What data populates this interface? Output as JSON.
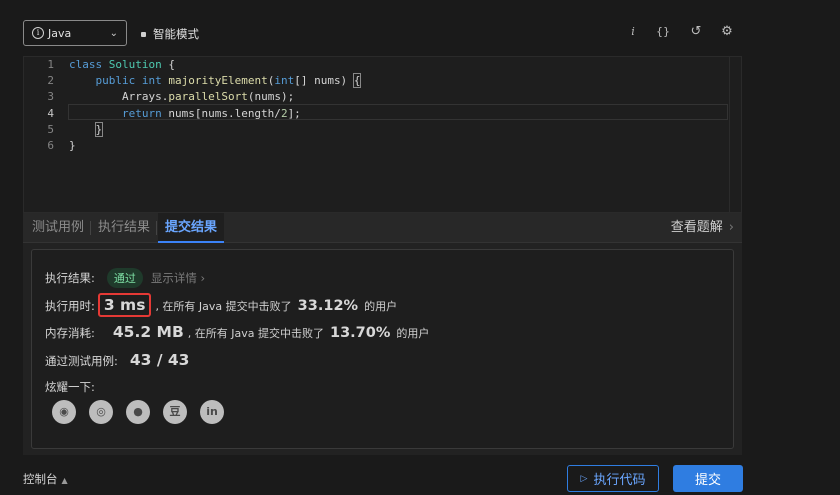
{
  "toolbar": {
    "language": "Java",
    "smart_mode": "智能模式",
    "icons": [
      "info-icon",
      "braces-icon",
      "reset-icon",
      "settings-icon"
    ],
    "icon_glyphs": {
      "info": "i",
      "braces": "{}",
      "reset": "↺",
      "settings": "⚙"
    }
  },
  "editor": {
    "active_line": 4,
    "lines": [
      {
        "num": "1",
        "tokens": [
          {
            "t": "class ",
            "c": "kw"
          },
          {
            "t": "Solution",
            "c": "ty"
          },
          {
            "t": " {",
            "c": "pl"
          }
        ]
      },
      {
        "num": "2",
        "tokens": [
          {
            "t": "    ",
            "c": "pl"
          },
          {
            "t": "public ",
            "c": "kw"
          },
          {
            "t": "int ",
            "c": "kw"
          },
          {
            "t": "majorityElement",
            "c": "fn"
          },
          {
            "t": "(",
            "c": "pl"
          },
          {
            "t": "int",
            "c": "kw"
          },
          {
            "t": "[] nums) ",
            "c": "pl"
          },
          {
            "t": "{",
            "c": "br"
          }
        ]
      },
      {
        "num": "3",
        "tokens": [
          {
            "t": "        Arrays.",
            "c": "pl"
          },
          {
            "t": "parallelSort",
            "c": "fn"
          },
          {
            "t": "(nums);",
            "c": "pl"
          }
        ]
      },
      {
        "num": "4",
        "tokens": [
          {
            "t": "        ",
            "c": "pl"
          },
          {
            "t": "return ",
            "c": "kw"
          },
          {
            "t": "nums[nums.length/",
            "c": "pl"
          },
          {
            "t": "2",
            "c": "nu"
          },
          {
            "t": "];",
            "c": "pl"
          }
        ]
      },
      {
        "num": "5",
        "tokens": [
          {
            "t": "    ",
            "c": "pl"
          },
          {
            "t": "}",
            "c": "br"
          }
        ]
      },
      {
        "num": "6",
        "tokens": [
          {
            "t": "}",
            "c": "pl"
          }
        ]
      }
    ]
  },
  "tabs": {
    "test_cases": "测试用例",
    "run_result": "执行结果",
    "submit_result": "提交结果",
    "view_solutions": "查看题解",
    "arrow": "›"
  },
  "result": {
    "status_label": "执行结果:",
    "status": "通过",
    "details": "显示详情 ›",
    "runtime_label": "执行用时:",
    "runtime": "3 ms",
    "runtime_text": ", 在所有 Java 提交中击败了",
    "runtime_pct": "33.12%",
    "users": "的用户",
    "memory_label": "内存消耗:",
    "memory": "45.2 MB",
    "memory_text": ", 在所有 Java 提交中击败了",
    "memory_pct": "13.70%",
    "cases_label": "通过测试用例:",
    "cases": "43 / 43",
    "share_label": "炫耀一下:",
    "share_icons": [
      "wechat-icon",
      "weibo-icon",
      "qq-icon",
      "douban-icon",
      "linkedin-icon"
    ],
    "share_glyphs": {
      "wechat": "◉",
      "weibo": "◎",
      "qq": "●",
      "douban": "豆",
      "linkedin": "in"
    }
  },
  "footer": {
    "console": "控制台",
    "console_arrow": "▲",
    "run_code": "执行代码",
    "run_glyph": "▷",
    "submit": "提交"
  }
}
